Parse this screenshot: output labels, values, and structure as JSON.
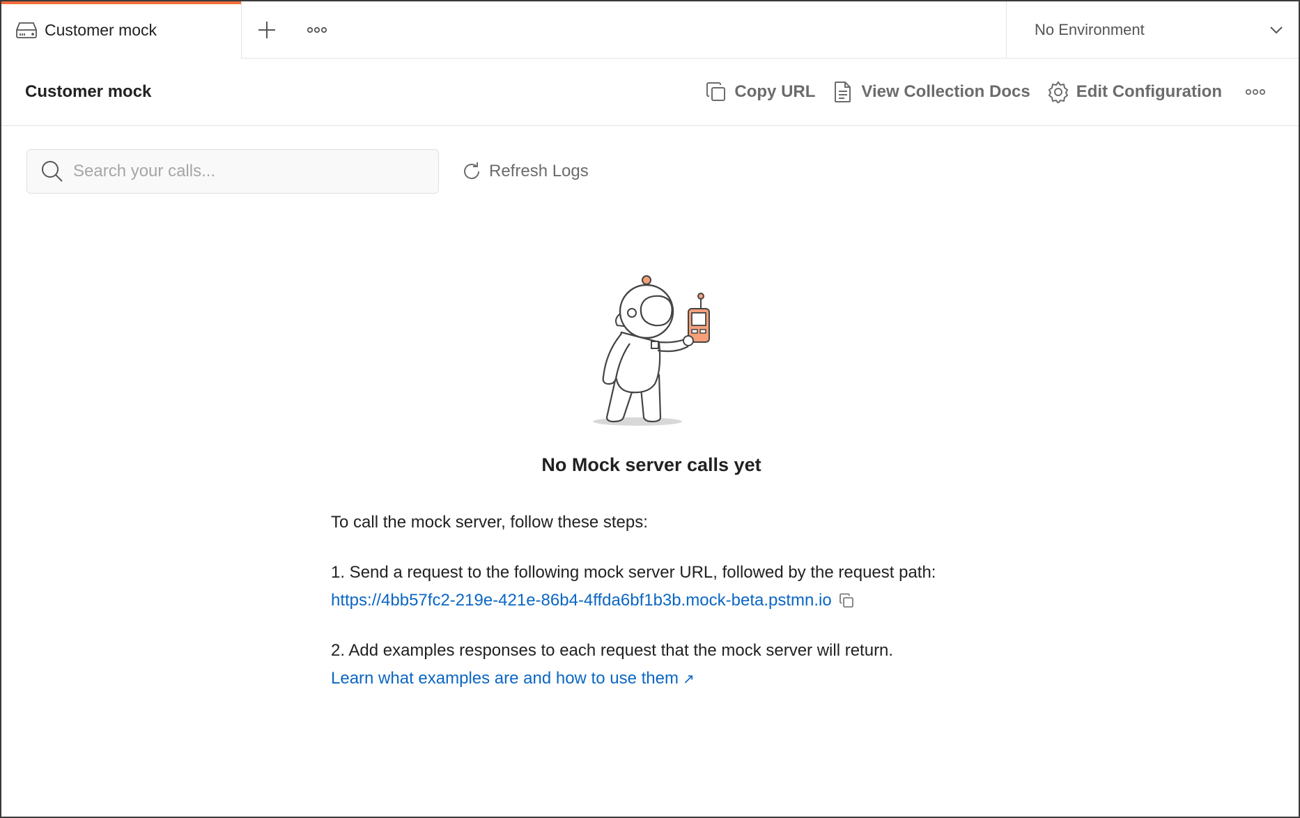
{
  "tabbar": {
    "active_tab_title": "Customer mock",
    "environment": "No Environment"
  },
  "header": {
    "title": "Customer mock",
    "copy_url": "Copy URL",
    "view_docs": "View Collection Docs",
    "edit_config": "Edit Configuration"
  },
  "toolbar": {
    "search_placeholder": "Search your calls...",
    "refresh": "Refresh Logs"
  },
  "empty_state": {
    "title": "No Mock server calls yet",
    "intro": "To call the mock server, follow these steps:",
    "step1": "1. Send a request to the following mock server URL, followed by the request path:",
    "mock_url": "https://4bb57fc2-219e-421e-86b4-4ffda6bf1b3b.mock-beta.pstmn.io",
    "step2": "2. Add examples responses to each request that the mock server will return.",
    "learn_link": "Learn what examples are and how to use them",
    "learn_arrow": "↗"
  },
  "colors": {
    "accent": "#f26b3a",
    "link": "#0b66c3",
    "muted_text": "#6b6b6b"
  }
}
